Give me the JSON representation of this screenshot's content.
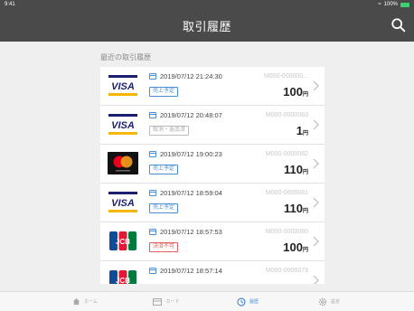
{
  "status": {
    "time": "9:41",
    "battery": "100%"
  },
  "header": {
    "title": "取引履歴"
  },
  "section_title": "最近の取引履歴",
  "transactions": [
    {
      "brand": "visa",
      "datetime": "2019/07/12 21:24:30",
      "status": "売上予定",
      "status_type": "blue",
      "id": "M000-000000...",
      "amount": "100",
      "currency": "円"
    },
    {
      "brand": "visa",
      "datetime": "2019/07/12 20:48:07",
      "status": "取消・返品済",
      "status_type": "gray",
      "id": "M000-0000083",
      "amount": "1",
      "currency": "円"
    },
    {
      "brand": "mastercard",
      "datetime": "2019/07/12 19:00:23",
      "status": "売上予定",
      "status_type": "blue",
      "id": "M000-0000082",
      "amount": "110",
      "currency": "円"
    },
    {
      "brand": "visa",
      "datetime": "2019/07/12 18:59:04",
      "status": "売上予定",
      "status_type": "blue",
      "id": "M000-0000081",
      "amount": "110",
      "currency": "円"
    },
    {
      "brand": "jcb",
      "datetime": "2019/07/12 18:57:53",
      "status": "決済不可",
      "status_type": "red",
      "id": "M000-0000080",
      "amount": "100",
      "currency": "円"
    },
    {
      "brand": "jcb",
      "datetime": "2019/07/12 18:57:14",
      "status": "",
      "status_type": "blue",
      "id": "M000-0000079",
      "amount": "",
      "currency": ""
    }
  ],
  "tabs": [
    {
      "label": "ホーム",
      "icon": "home-icon",
      "active": false
    },
    {
      "label": "カード",
      "icon": "card-icon",
      "active": false
    },
    {
      "label": "履歴",
      "icon": "history-icon",
      "active": true
    },
    {
      "label": "設定",
      "icon": "settings-icon",
      "active": false
    }
  ],
  "colors": {
    "header": "#4a4a4a",
    "accent": "#4a8fd6",
    "visa_blue": "#1a1f71",
    "visa_gold": "#f7b600"
  }
}
